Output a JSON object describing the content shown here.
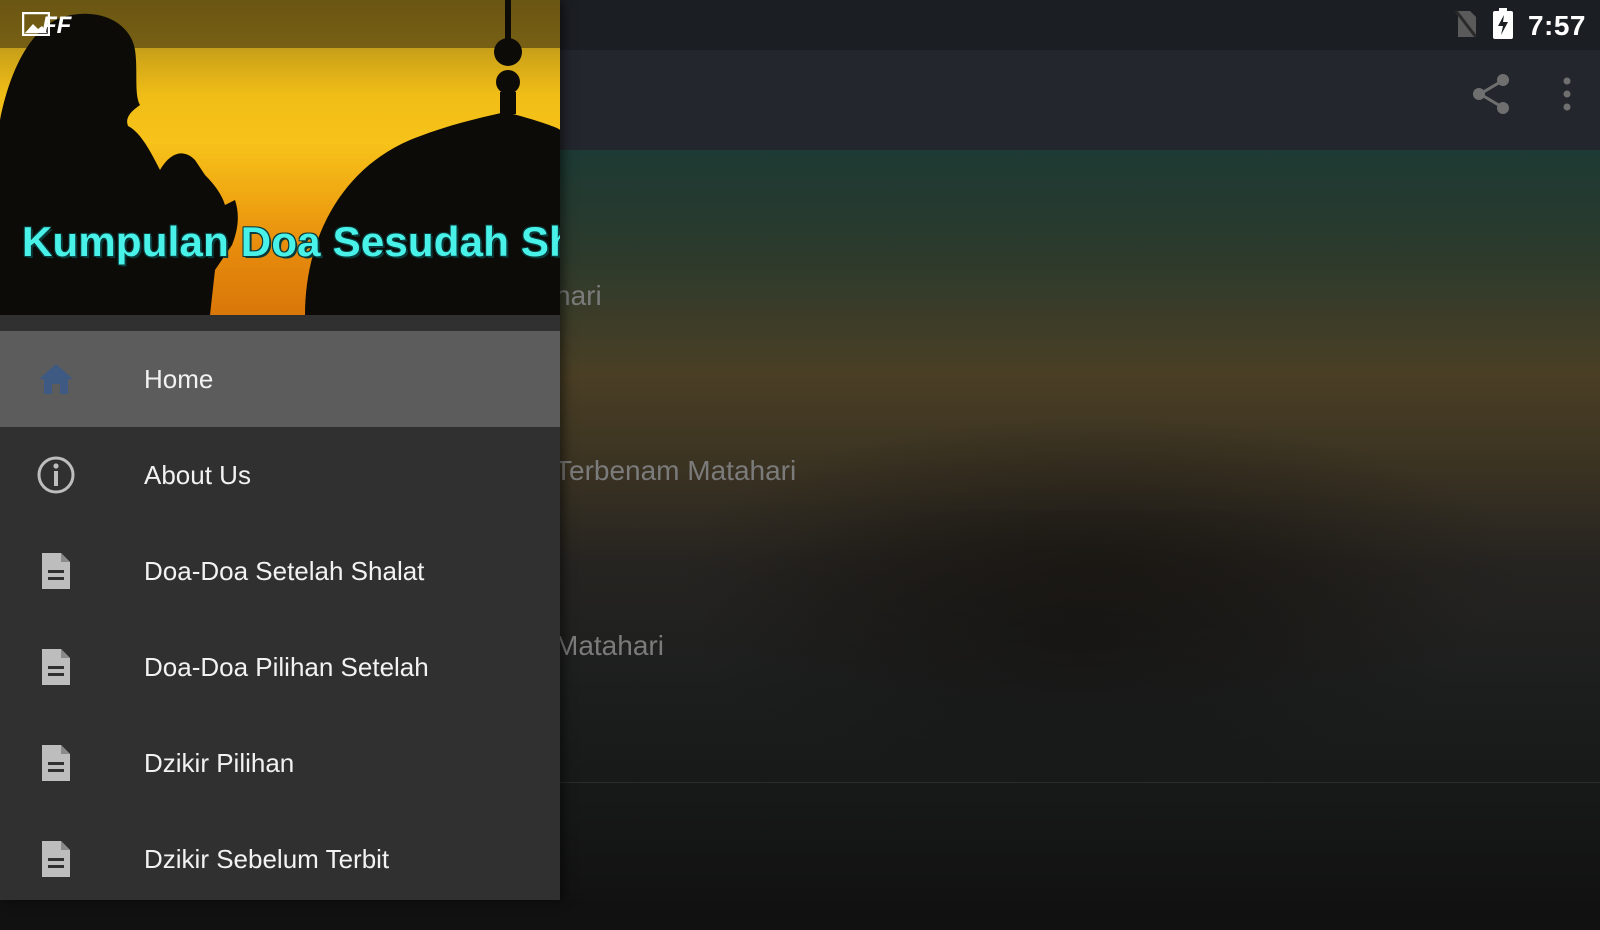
{
  "status_bar": {
    "time": "7:57",
    "left_icons": [
      "gallery-icon",
      "ff-badge"
    ],
    "left_label": "FF",
    "right_icons": [
      "no-sim-icon",
      "battery-charging-icon"
    ]
  },
  "toolbar": {
    "actions": [
      "share-icon",
      "overflow-menu-icon"
    ]
  },
  "background_list": [
    {
      "text": "hari"
    },
    {
      "text": "Terbenam Matahari"
    },
    {
      "text": "Matahari"
    }
  ],
  "drawer": {
    "header_title": "Kumpulan Doa Sesudah Sholat",
    "items": [
      {
        "label": "Home",
        "icon": "home-icon",
        "active": true
      },
      {
        "label": "About Us",
        "icon": "info-icon",
        "active": false
      },
      {
        "label": "Doa-Doa Setelah Shalat",
        "icon": "document-icon",
        "active": false
      },
      {
        "label": "Doa-Doa Pilihan Setelah",
        "icon": "document-icon",
        "active": false
      },
      {
        "label": "Dzikir Pilihan",
        "icon": "document-icon",
        "active": false
      },
      {
        "label": "Dzikir Sebelum Terbit",
        "icon": "document-icon",
        "active": false
      }
    ]
  },
  "colors": {
    "header_title": "#49f2e8",
    "drawer_bg": "#303030",
    "active_item_bg": "#5c5c5c",
    "home_icon": "#3f5a82"
  }
}
